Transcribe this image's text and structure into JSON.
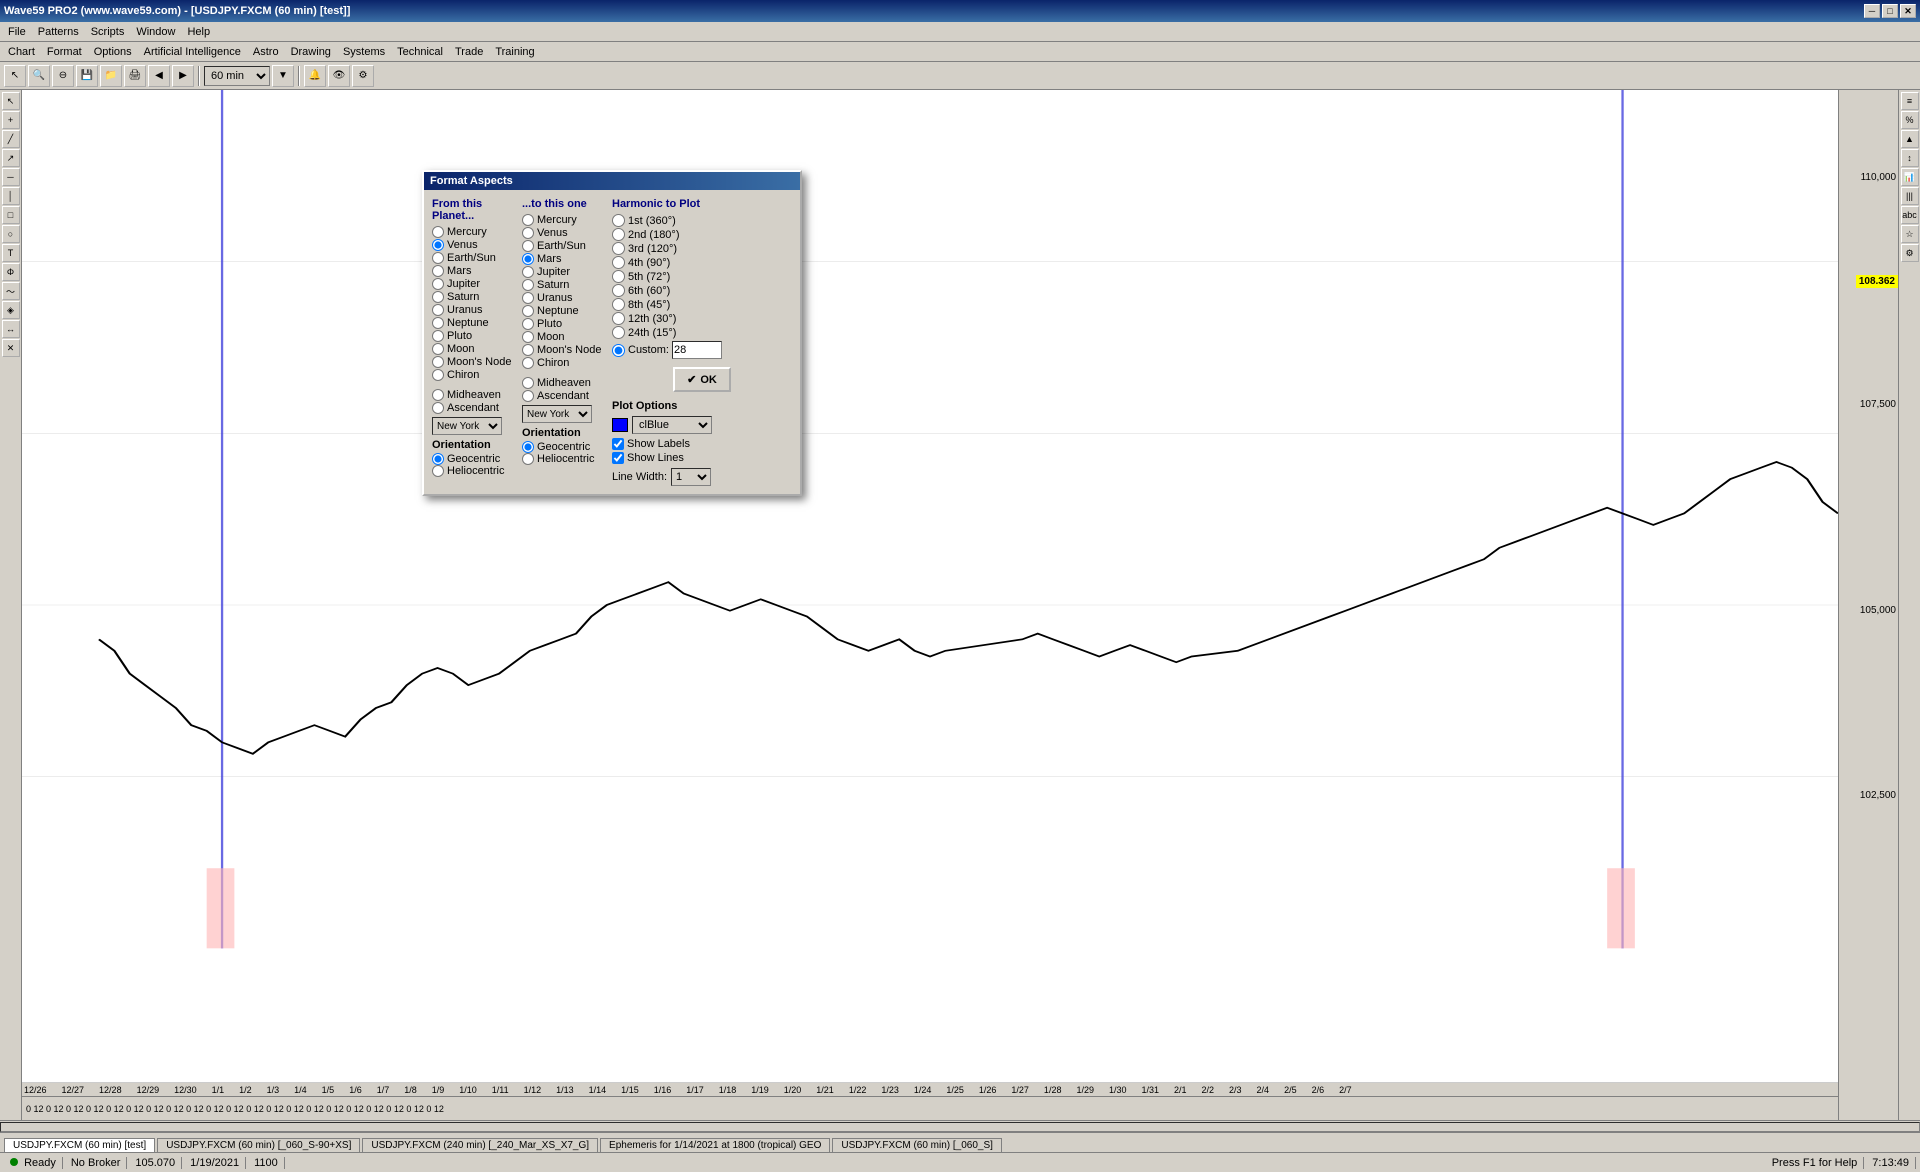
{
  "window": {
    "title": "Wave59 PRO2 (www.wave59.com) - [USDJPY.FXCM (60 min) [test]]",
    "inner_title": "USDJPY.FXCM (60 min) [test]"
  },
  "title_bar": {
    "minimize": "─",
    "restore": "□",
    "close": "✕"
  },
  "menus": {
    "main": [
      "File",
      "Patterns",
      "Scripts",
      "Window",
      "Help"
    ],
    "sub": [
      "Chart",
      "Format",
      "Options",
      "Artificial Intelligence",
      "Astro",
      "Drawing",
      "Systems",
      "Technical",
      "Trade",
      "Training"
    ]
  },
  "toolbar": {
    "timeframe": "60 min"
  },
  "dialog": {
    "title": "Format Aspects",
    "from_col_title": "From this Planet...",
    "to_col_title": "...to this one",
    "harmonic_title": "Harmonic to Plot",
    "from_planets": [
      {
        "label": "Mercury",
        "value": "mercury",
        "selected": false
      },
      {
        "label": "Venus",
        "value": "venus",
        "selected": true
      },
      {
        "label": "Earth/Sun",
        "value": "earth_sun",
        "selected": false
      },
      {
        "label": "Mars",
        "value": "mars",
        "selected": false
      },
      {
        "label": "Jupiter",
        "value": "jupiter",
        "selected": false
      },
      {
        "label": "Saturn",
        "value": "saturn",
        "selected": false
      },
      {
        "label": "Uranus",
        "value": "uranus",
        "selected": false
      },
      {
        "label": "Neptune",
        "value": "neptune",
        "selected": false
      },
      {
        "label": "Pluto",
        "value": "pluto",
        "selected": false
      },
      {
        "label": "Moon",
        "value": "moon",
        "selected": false
      },
      {
        "label": "Moon's Node",
        "value": "moons_node",
        "selected": false
      },
      {
        "label": "Chiron",
        "value": "chiron",
        "selected": false
      }
    ],
    "from_extra": [
      {
        "label": "Midheaven",
        "value": "midheaven",
        "selected": false
      },
      {
        "label": "Ascendant",
        "value": "ascendant",
        "selected": false
      }
    ],
    "from_city": "New York",
    "to_planets": [
      {
        "label": "Mercury",
        "value": "mercury",
        "selected": false
      },
      {
        "label": "Venus",
        "value": "venus",
        "selected": false
      },
      {
        "label": "Earth/Sun",
        "value": "earth_sun",
        "selected": false
      },
      {
        "label": "Mars",
        "value": "mars",
        "selected": true
      },
      {
        "label": "Jupiter",
        "value": "jupiter",
        "selected": false
      },
      {
        "label": "Saturn",
        "value": "saturn",
        "selected": false
      },
      {
        "label": "Uranus",
        "value": "uranus",
        "selected": false
      },
      {
        "label": "Neptune",
        "value": "neptune",
        "selected": false
      },
      {
        "label": "Pluto",
        "value": "pluto",
        "selected": false
      },
      {
        "label": "Moon",
        "value": "moon",
        "selected": false
      },
      {
        "label": "Moon's Node",
        "value": "moons_node",
        "selected": false
      },
      {
        "label": "Chiron",
        "value": "chiron",
        "selected": false
      }
    ],
    "to_extra": [
      {
        "label": "Midheaven",
        "value": "midheaven",
        "selected": false
      },
      {
        "label": "Ascendant",
        "value": "ascendant",
        "selected": false
      }
    ],
    "to_city": "New York",
    "harmonics": [
      {
        "label": "1st (360°)",
        "value": "1st",
        "selected": false
      },
      {
        "label": "2nd (180°)",
        "value": "2nd",
        "selected": false
      },
      {
        "label": "3rd (120°)",
        "value": "3rd",
        "selected": false
      },
      {
        "label": "4th (90°)",
        "value": "4th",
        "selected": false
      },
      {
        "label": "5th (72°)",
        "value": "5th",
        "selected": false
      },
      {
        "label": "6th (60°)",
        "value": "6th",
        "selected": false
      },
      {
        "label": "8th (45°)",
        "value": "8th",
        "selected": false
      },
      {
        "label": "12th (30°)",
        "value": "12th",
        "selected": false
      },
      {
        "label": "24th (15°)",
        "value": "24th",
        "selected": false
      }
    ],
    "custom_label": "Custom:",
    "custom_value": "28",
    "custom_selected": true,
    "plot_options_title": "Plot Options",
    "color_label": "clBlue",
    "show_labels": "Show Labels",
    "show_labels_checked": true,
    "show_lines": "Show Lines",
    "show_lines_checked": true,
    "line_width_label": "Line Width:",
    "line_width_value": "1",
    "orientation_label": "Orientation",
    "geocentric_label": "Geocentric",
    "heliocentric_label": "Heliocentric",
    "from_geocentric": true,
    "to_geocentric": true,
    "ok_label": "OK",
    "ok_check": "✔"
  },
  "price_levels": [
    {
      "value": "110,000",
      "y_pct": 15
    },
    {
      "value": "108.362",
      "y_pct": 28,
      "highlight": true
    },
    {
      "value": "107,500",
      "y_pct": 38
    },
    {
      "value": "105,000",
      "y_pct": 58
    },
    {
      "value": "102,500",
      "y_pct": 78
    }
  ],
  "status_bar": {
    "ready": "Ready",
    "no_broker": "No Broker",
    "price": "105.070",
    "date": "1/19/2021",
    "time": "1100",
    "f1_help": "Press F1 for Help",
    "clock": "7:13:49"
  },
  "tabs": [
    {
      "label": "USDJPY.FXCM (60 min) [test]",
      "active": true
    },
    {
      "label": "USDJPY.FXCM (60 min) [_060_S-90+XS]",
      "active": false
    },
    {
      "label": "USDJPY.FXCM (240 min) [_240_Mar_XS_X7_G]",
      "active": false
    },
    {
      "label": "Ephemeris for 1/14/2021 at 1800 (tropical) GEO",
      "active": false
    },
    {
      "label": "USDJPY.FXCM (60 min) [_060_S]",
      "active": false
    }
  ],
  "date_labels": [
    "12/26",
    "12/27",
    "12/28",
    "12/29",
    "12/30",
    "1/1",
    "1/2",
    "1/3",
    "1/4",
    "1/5",
    "1/6",
    "1/7",
    "1/8",
    "1/9",
    "1/10",
    "1/11",
    "1/12",
    "1/13",
    "1/14",
    "1/15",
    "1/16",
    "1/17",
    "1/18",
    "1/19",
    "1/20",
    "1/21",
    "1/22",
    "1/23",
    "1/24",
    "1/25",
    "1/26",
    "1/27",
    "1/28",
    "1/29",
    "1/30",
    "1/31",
    "2/1",
    "2/2",
    "2/3",
    "2/4",
    "2/5",
    "2/6",
    "2/7"
  ]
}
